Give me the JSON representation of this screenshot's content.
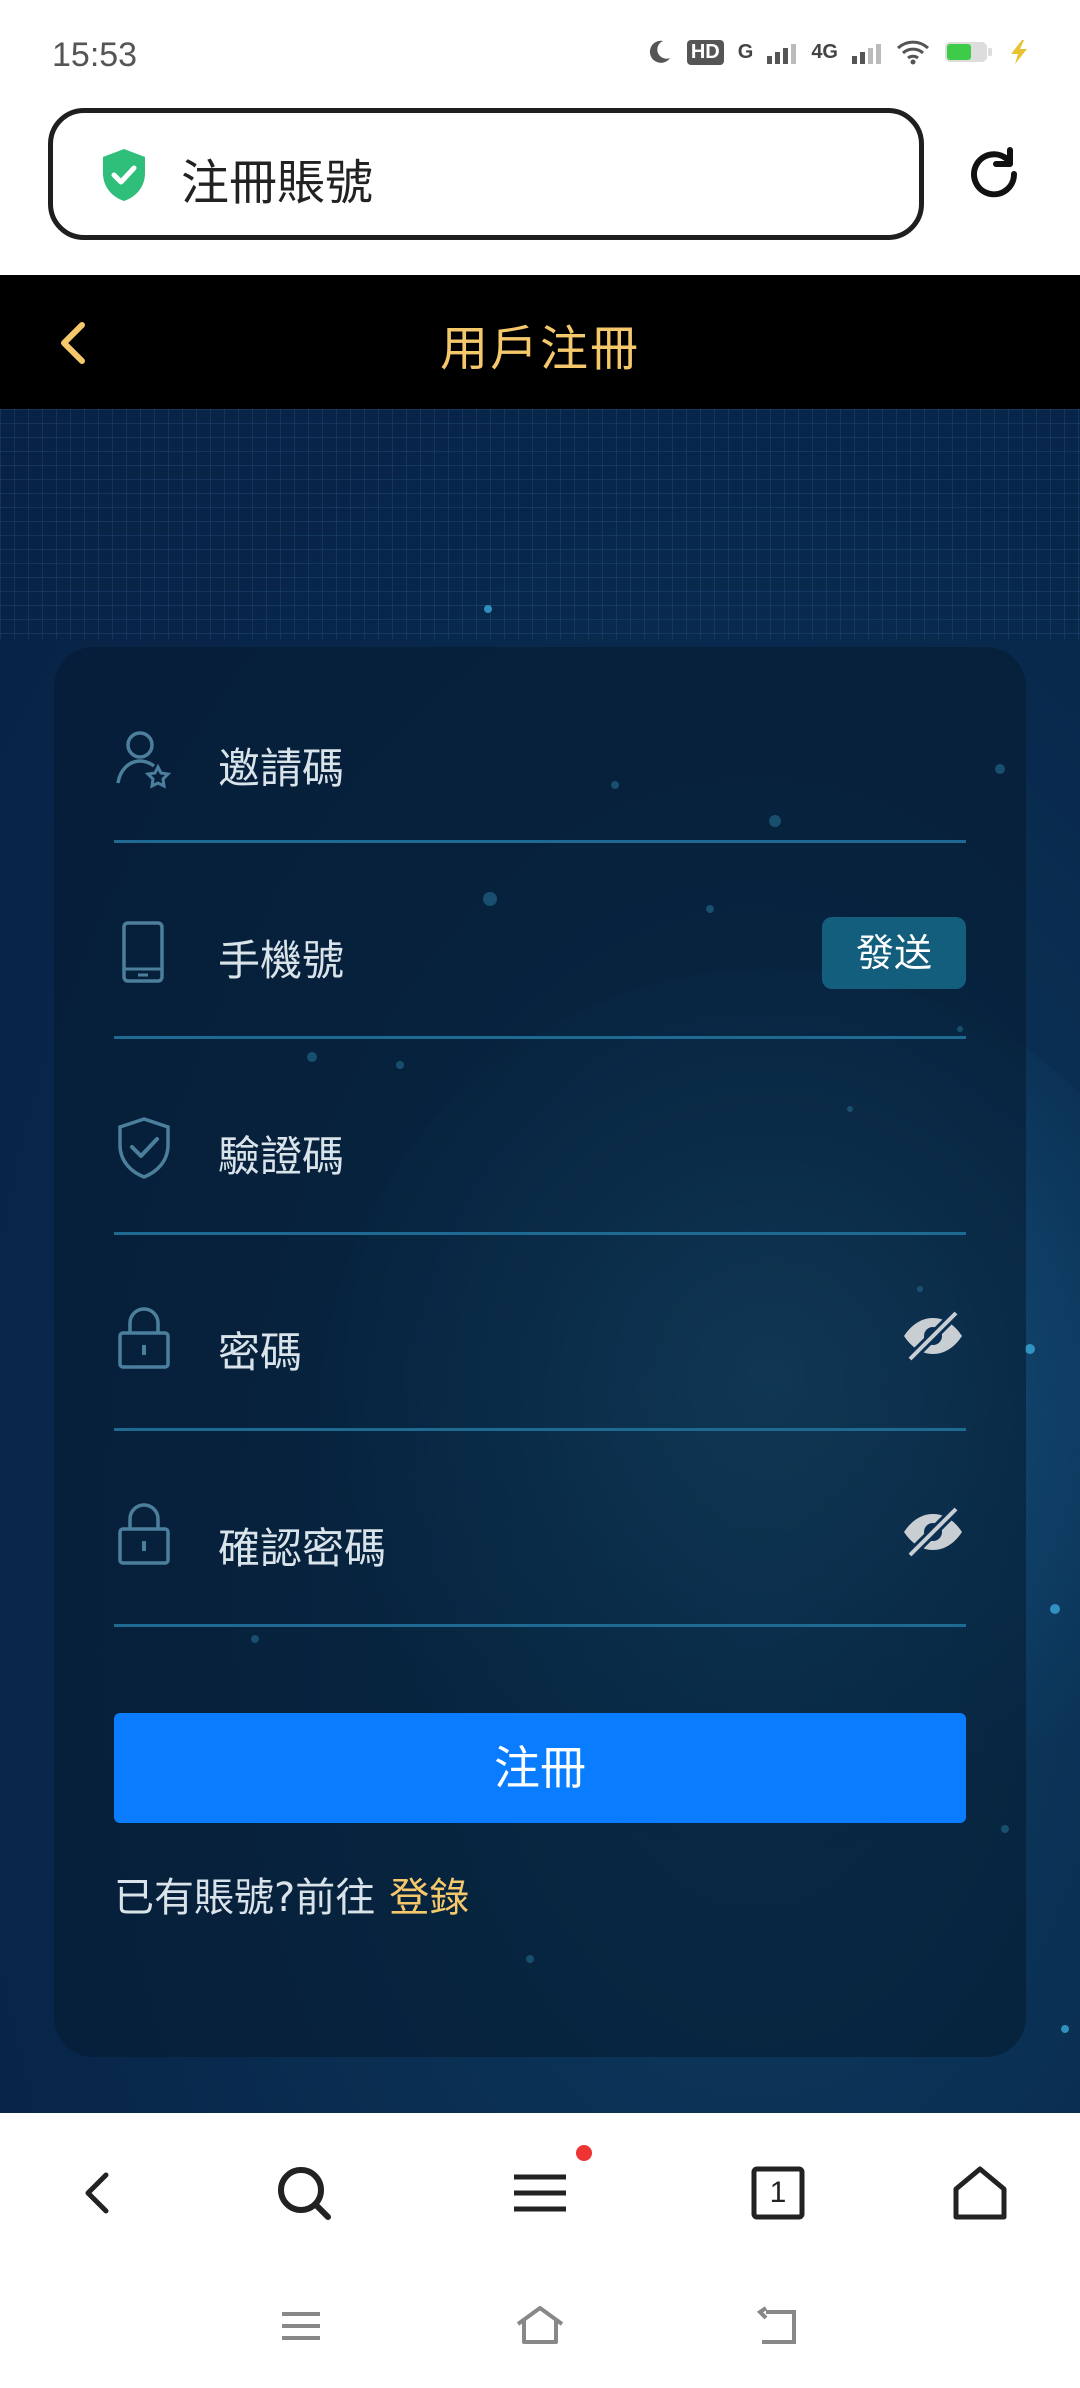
{
  "status_bar": {
    "time": "15:53",
    "network_1": "HD",
    "network_2": "G",
    "network_3": "4G"
  },
  "address_bar": {
    "title": "注冊賬號"
  },
  "header": {
    "title": "用戶注冊"
  },
  "form": {
    "invite_code_label": "邀請碼",
    "phone_label": "手機號",
    "send_button": "發送",
    "verify_code_label": "驗證碼",
    "password_label": "密碼",
    "confirm_password_label": "確認密碼",
    "register_button": "注冊",
    "login_prompt": "已有賬號?前往",
    "login_link": "登錄"
  },
  "toolbar": {
    "tab_count": "1"
  },
  "colors": {
    "accent_gold": "#f5c96b",
    "primary_blue": "#0a7cff",
    "send_teal": "#135d7d"
  }
}
